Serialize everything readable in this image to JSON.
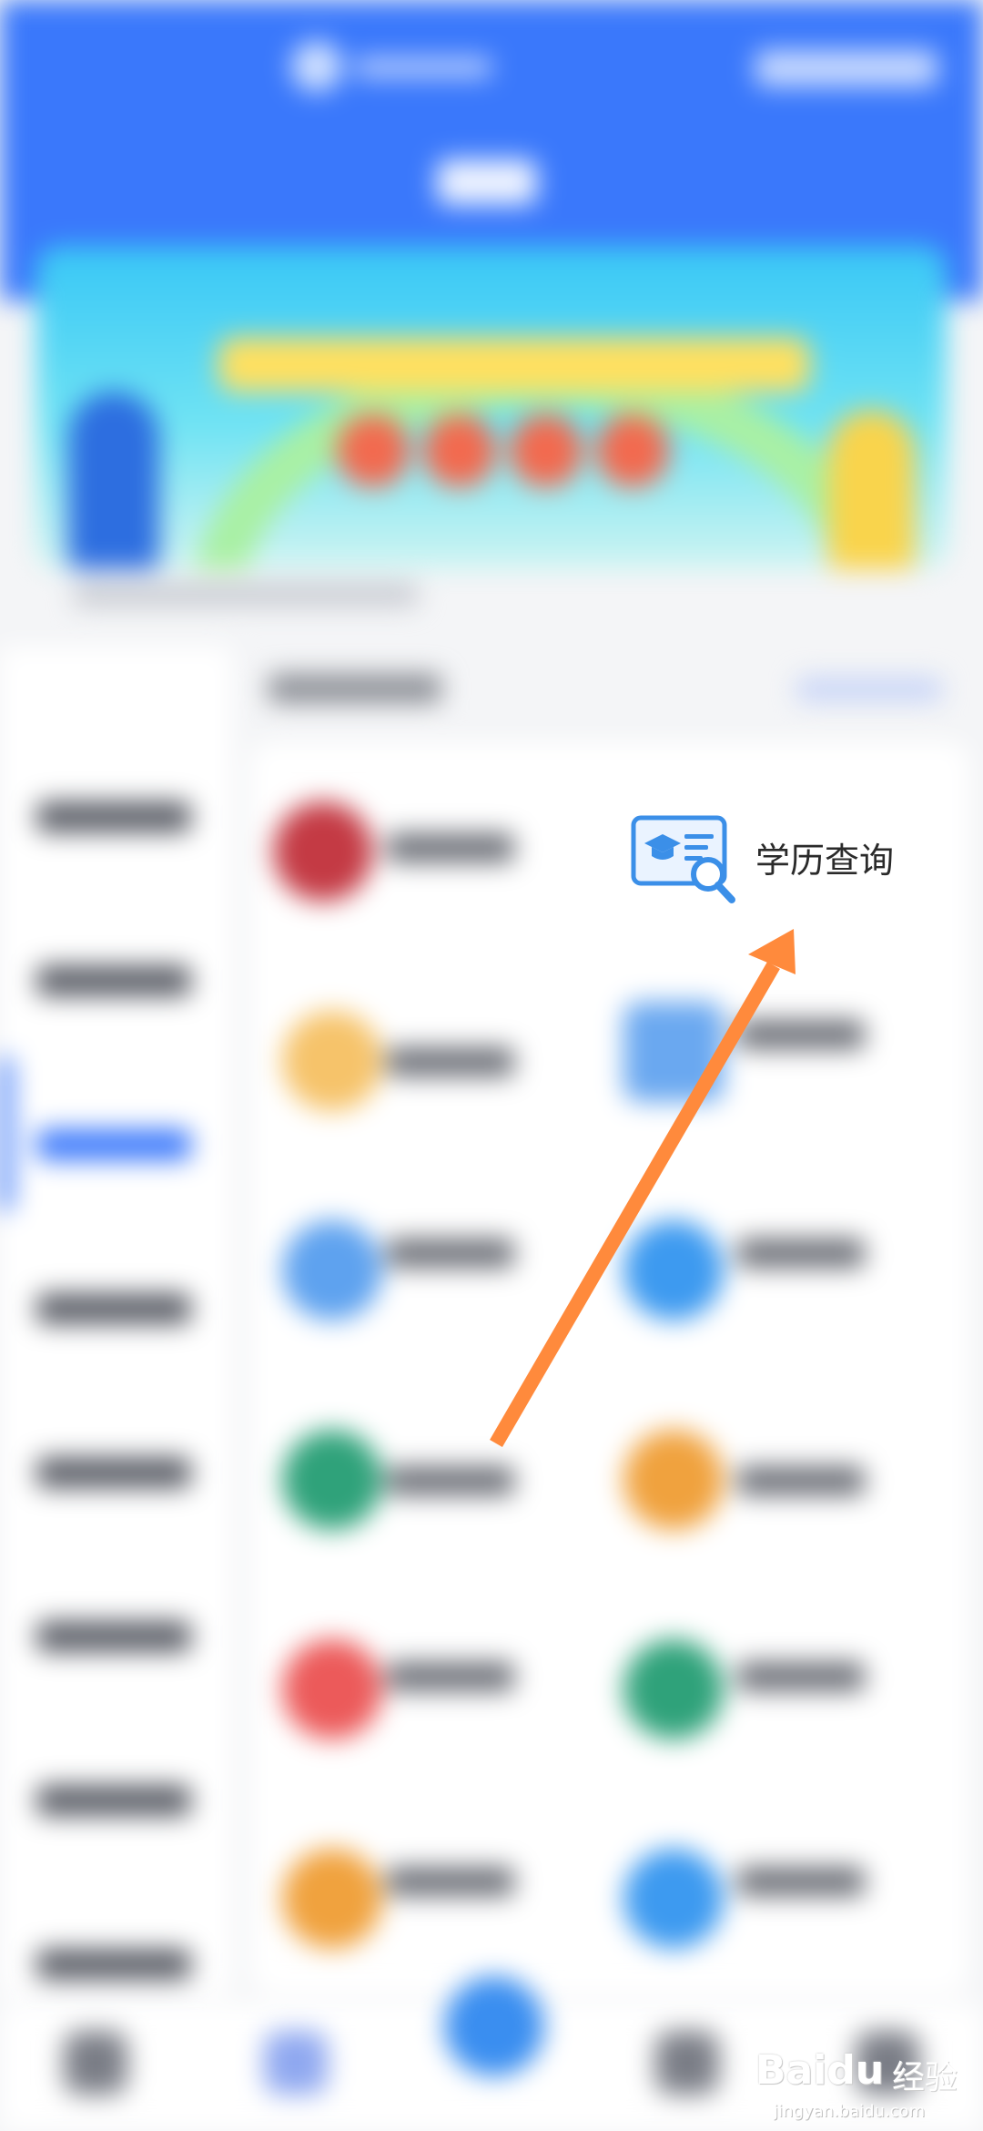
{
  "highlight_item": {
    "label": "学历查询",
    "icon": "diploma-search-icon"
  },
  "annotation": {
    "arrow_color": "#ff8a3c"
  },
  "watermark": {
    "brand": "Baidu",
    "brand_cn": "经验",
    "site": "jingyan.baidu.com"
  },
  "colors": {
    "header_blue": "#3a78fb",
    "icon_blue": "#3b8fe8"
  }
}
